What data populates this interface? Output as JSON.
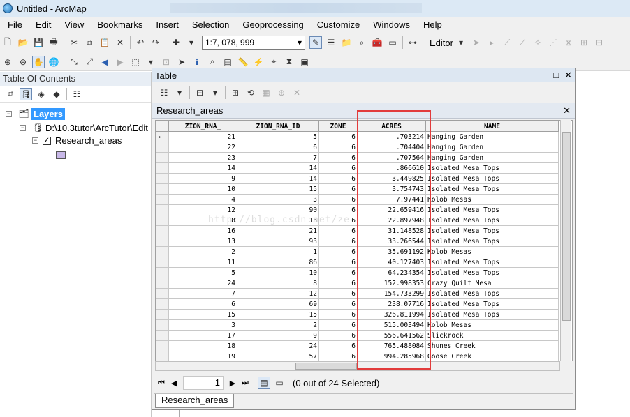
{
  "window": {
    "title": "Untitled - ArcMap"
  },
  "menu": [
    "File",
    "Edit",
    "View",
    "Bookmarks",
    "Insert",
    "Selection",
    "Geoprocessing",
    "Customize",
    "Windows",
    "Help"
  ],
  "toolbar": {
    "scale": "1:7, 078, 999",
    "editor_label": "Editor"
  },
  "toc": {
    "title": "Table Of Contents",
    "root": "Layers",
    "source": "D:\\10.3tutor\\ArcTutor\\Edit",
    "layer": "Research_areas"
  },
  "table": {
    "window_title": "Table",
    "tab_title": "Research_areas",
    "columns": [
      "ZION_RNA_",
      "ZION_RNA_ID",
      "ZONE",
      "ACRES",
      "NAME"
    ],
    "rows": [
      [
        "21",
        "5",
        "6",
        ".703214",
        "Hanging Garden"
      ],
      [
        "22",
        "6",
        "6",
        ".704404",
        "Hanging Garden"
      ],
      [
        "23",
        "7",
        "6",
        ".707564",
        "Hanging Garden"
      ],
      [
        "14",
        "14",
        "6",
        ".866610",
        "Isolated Mesa Tops"
      ],
      [
        "9",
        "14",
        "6",
        "3.449825",
        "Isolated Mesa Tops"
      ],
      [
        "10",
        "15",
        "6",
        "3.754743",
        "Isolated Mesa Tops"
      ],
      [
        "4",
        "3",
        "6",
        "7.97441",
        "Kolob Mesas"
      ],
      [
        "12",
        "90",
        "6",
        "22.659416",
        "Isolated Mesa Tops"
      ],
      [
        "8",
        "13",
        "6",
        "22.897948",
        "Isolated Mesa Tops"
      ],
      [
        "16",
        "21",
        "6",
        "31.148528",
        "Isolated Mesa Tops"
      ],
      [
        "13",
        "93",
        "6",
        "33.266544",
        "Isolated Mesa Tops"
      ],
      [
        "2",
        "1",
        "6",
        "35.691192",
        "Kolob Mesas"
      ],
      [
        "11",
        "86",
        "6",
        "40.127403",
        "Isolated Mesa Tops"
      ],
      [
        "5",
        "10",
        "6",
        "64.234354",
        "Isolated Mesa Tops"
      ],
      [
        "24",
        "8",
        "6",
        "152.998353",
        "Crazy Quilt Mesa"
      ],
      [
        "7",
        "12",
        "6",
        "154.733299",
        "Isolated Mesa Tops"
      ],
      [
        "6",
        "69",
        "6",
        "238.07716",
        "Isolated Mesa Tops"
      ],
      [
        "15",
        "15",
        "6",
        "326.811994",
        "Isolated Mesa Tops"
      ],
      [
        "3",
        "2",
        "6",
        "515.003494",
        "Kolob Mesas"
      ],
      [
        "17",
        "9",
        "6",
        "556.641562",
        "Slickrock"
      ],
      [
        "18",
        "24",
        "6",
        "765.488084",
        "Shunes Creek"
      ],
      [
        "19",
        "57",
        "6",
        "994.285968",
        "Goose Creek"
      ]
    ],
    "record_current": "1",
    "selection_status": "(0 out of 24 Selected)",
    "bottom_tab": "Research_areas"
  },
  "watermark": "http://blog.csdn.net/ze",
  "colors": {
    "highlight": "#e23b3b",
    "selection_blue": "#3399ff"
  }
}
